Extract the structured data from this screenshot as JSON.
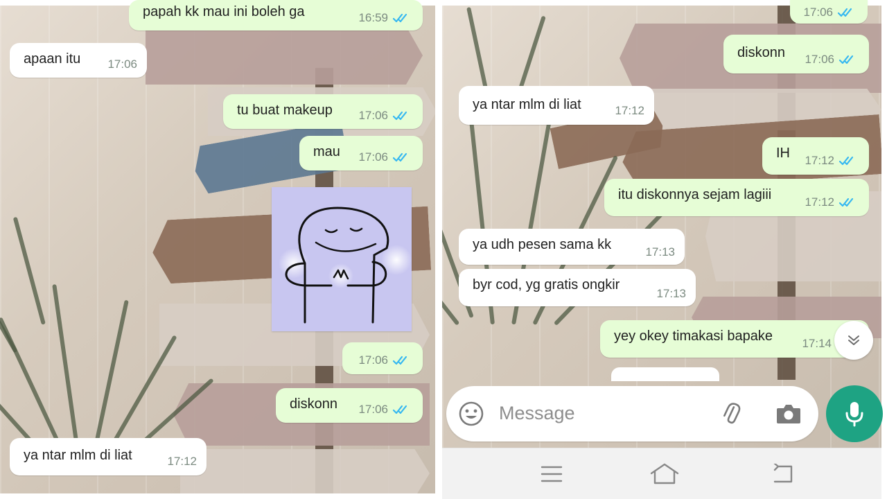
{
  "left_panel": {
    "messages": [
      {
        "side": "out",
        "text": "papah kk mau ini boleh ga",
        "time": "16:59",
        "read": true
      },
      {
        "side": "in",
        "text": "apaan itu",
        "time": "17:06"
      },
      {
        "side": "out",
        "text": "tu buat makeup",
        "time": "17:06",
        "read": true
      },
      {
        "side": "out",
        "text": "mau",
        "time": "17:06",
        "read": true
      },
      {
        "side": "out",
        "sticker": "praying-sticker",
        "time": "17:06",
        "read": true
      },
      {
        "side": "out",
        "text": "diskonn",
        "time": "17:06",
        "read": true
      },
      {
        "side": "in",
        "text": "ya ntar mlm di liat",
        "time": "17:12"
      }
    ]
  },
  "right_panel": {
    "messages": [
      {
        "side": "out",
        "text": "",
        "time": "17:06",
        "read": true
      },
      {
        "side": "out",
        "text": "diskonn",
        "time": "17:06",
        "read": true
      },
      {
        "side": "in",
        "text": "ya ntar mlm di liat",
        "time": "17:12"
      },
      {
        "side": "out",
        "text": "IH",
        "time": "17:12",
        "read": true
      },
      {
        "side": "out",
        "text": "itu diskonnya sejam lagiii",
        "time": "17:12",
        "read": true
      },
      {
        "side": "in",
        "text": "ya udh pesen sama kk",
        "time": "17:13"
      },
      {
        "side": "in",
        "text": "byr cod, yg gratis ongkir",
        "time": "17:13"
      },
      {
        "side": "out",
        "text": "yey okey timakasi bapake",
        "time": "17:14",
        "read": true
      }
    ],
    "composer": {
      "placeholder": "Message",
      "icons": [
        "emoji-icon",
        "attach-icon",
        "camera-icon"
      ],
      "send_icon": "mic-icon"
    },
    "scroll_button_icon": "chevron-double-down-icon",
    "nav_icons": [
      "menu-icon",
      "home-icon",
      "back-icon"
    ]
  },
  "colors": {
    "outgoing_bubble": "#e6fdd6",
    "incoming_bubble": "#ffffff",
    "read_tick": "#34b7f1",
    "mic_button": "#1ea383",
    "time_text": "#7b8a80"
  }
}
